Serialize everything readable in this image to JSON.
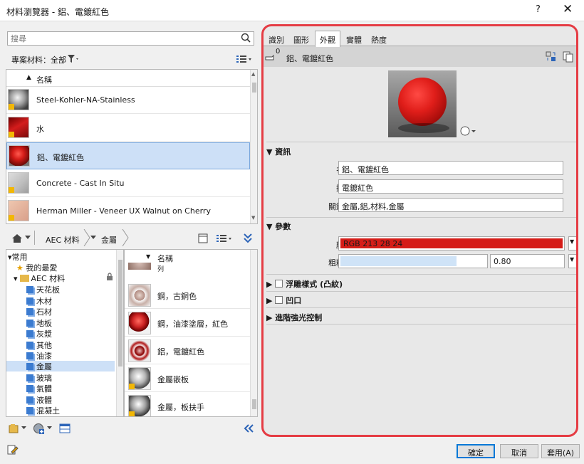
{
  "window": {
    "title": "材料瀏覽器 - 鋁、電鍍紅色",
    "help": "?",
    "close": "✕"
  },
  "search": {
    "placeholder": "搜尋"
  },
  "project_materials": {
    "label": "專案材料：全部",
    "filter_icon": "funnel-icon",
    "view_icon": "list-view-icon"
  },
  "material_list": {
    "header": "名稱",
    "items": [
      {
        "name": "Steel-Kohler-NA-Stainless",
        "swatch": "#9a9a9a"
      },
      {
        "name": "水",
        "swatch": "#c41a1a"
      },
      {
        "name": "鋁、電鍍紅色",
        "swatch": "#d51c18"
      },
      {
        "name": "Concrete - Cast In Situ",
        "swatch": "#c8c8c8"
      },
      {
        "name": "Herman Miller - Veneer UX Walnut on Cherry",
        "swatch": "#e2b49c"
      }
    ]
  },
  "breadcrumb": {
    "items": [
      "AEC 材料",
      "金屬"
    ]
  },
  "tree": {
    "favorites_group": "常用",
    "favorites": "我的最愛",
    "library": "AEC 材料",
    "categories": [
      "天花板",
      "木材",
      "石材",
      "地板",
      "灰漿",
      "其他",
      "油漆",
      "金屬",
      "玻璃",
      "氣體",
      "液體",
      "混凝土"
    ],
    "selected": "金屬"
  },
  "library_list": {
    "header": "名稱",
    "partial_item": "列",
    "items": [
      {
        "name": "鋼，古銅色",
        "swatch": "#a8928a"
      },
      {
        "name": "鋼，油漆塗層，紅色",
        "swatch": "#cc2222"
      },
      {
        "name": "鋁，電鍍紅色",
        "swatch": "#b01818"
      },
      {
        "name": "金屬嵌板",
        "swatch": "#b4b4b4"
      },
      {
        "name": "金屬，板扶手",
        "swatch": "#a0a0a0"
      }
    ]
  },
  "editor": {
    "tabs": [
      "識別",
      "圖形",
      "外觀",
      "實體",
      "熱度"
    ],
    "active_tab": "外觀",
    "header_count": "0",
    "header_name": "鋁、電鍍紅色",
    "info_section": "資訊",
    "name_label": "名稱",
    "name_value": "鋁、電鍍紅色",
    "desc_label": "描述",
    "desc_value": "電鍍紅色",
    "keywords_label": "關鍵字",
    "keywords_value": "金屬,鋁,材料,金屬",
    "params_section": "參數",
    "color_label": "顏色",
    "color_value": "RGB 213 28 24",
    "color_hex": "#d51c18",
    "roughness_label": "粗糙度",
    "roughness_value": "0.80",
    "relief_section": "浮雕樣式 (凸紋)",
    "cutout_section": "凹口",
    "advanced_section": "進階強光控制"
  },
  "buttons": {
    "ok": "確定",
    "cancel": "取消",
    "apply": "套用(A)"
  }
}
